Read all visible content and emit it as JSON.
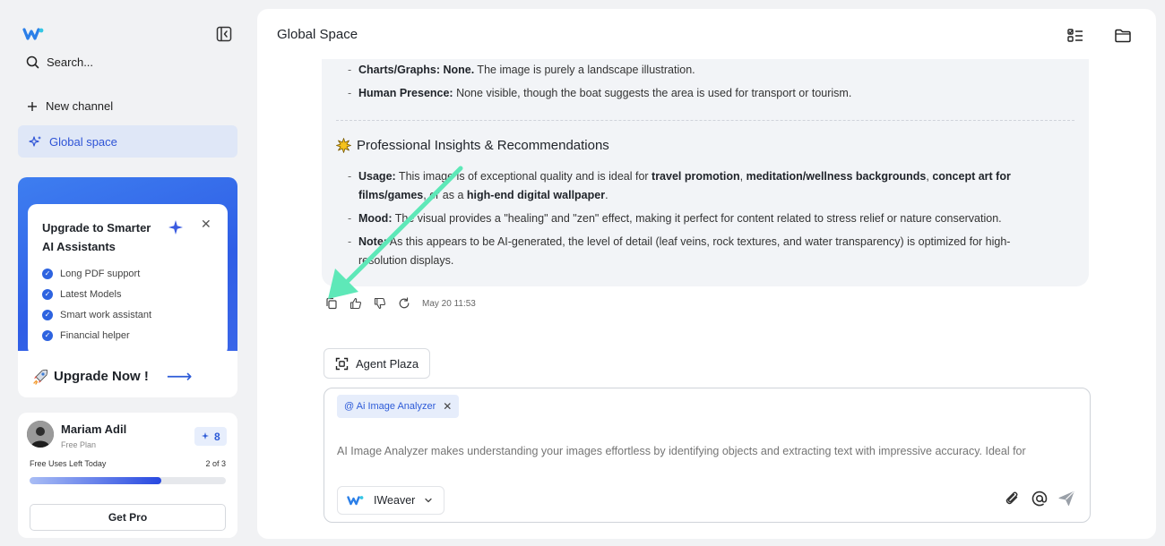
{
  "sidebar": {
    "search_label": "Search...",
    "new_channel_label": "New channel",
    "global_space_label": "Global space",
    "upgrade": {
      "title": "Upgrade to Smarter AI Assistants",
      "features": [
        "Long PDF support",
        "Latest Models",
        "Smart work assistant",
        "Financial helper"
      ],
      "cta_label": "Upgrade Now !"
    },
    "profile": {
      "name": "Mariam Adil",
      "plan": "Free Plan",
      "credits": "8",
      "uses_label": "Free Uses Left Today",
      "uses_count": "2 of 3",
      "uses_progress_fraction": 0.67,
      "get_pro_label": "Get Pro"
    }
  },
  "main": {
    "title": "Global Space",
    "message": {
      "items_top": [
        {
          "bold": "Charts/Graphs: None.",
          "text": " The image is purely a landscape illustration."
        },
        {
          "bold": "Human Presence:",
          "text": " None visible, though the boat suggests the area is used for transport or tourism."
        }
      ],
      "heading": "Professional Insights & Recommendations",
      "items_bottom": [
        {
          "bold": "Usage:",
          "text": " This image is of exceptional quality and is ideal for ",
          "bold2": "travel promotion",
          "text2": ", ",
          "bold3": "meditation/wellness backgrounds",
          "text3": ", ",
          "bold4": "concept art for films/games",
          "text4": ", or as a ",
          "bold5": "high-end digital wallpaper",
          "text5": "."
        },
        {
          "bold": "Mood:",
          "text": " The visual provides a \"healing\" and \"zen\" effect, making it perfect for content related to stress relief or nature conservation."
        },
        {
          "bold": "Note:",
          "text": " As this appears to be AI-generated, the level of detail (leaf veins, rock textures, and water transparency) is optimized for high-resolution displays."
        }
      ],
      "timestamp": "May 20 11:53"
    },
    "agent_plaza_label": "Agent Plaza",
    "composer": {
      "chip_label": "@ Ai Image Analyzer",
      "placeholder": "AI Image Analyzer makes understanding your images effortless by identifying objects and extracting text with impressive accuracy. Ideal for",
      "model_label": "IWeaver"
    }
  },
  "colors": {
    "accent": "#2d5bd8",
    "annotation_arrow": "#5ee8b8",
    "bubble_bg": "#f2f4f7"
  }
}
